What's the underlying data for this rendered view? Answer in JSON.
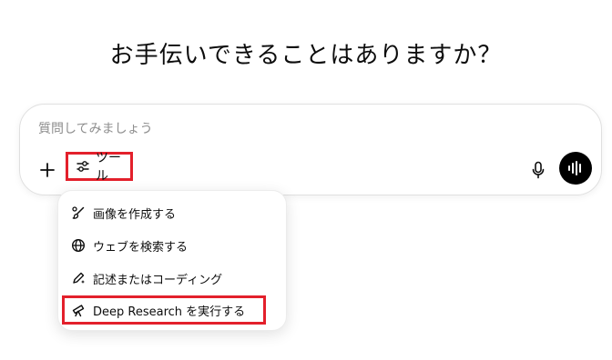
{
  "heading": "お手伝いできることはありますか？",
  "composer": {
    "placeholder": "質問してみましょう",
    "add_icon": "plus-icon",
    "tools_label": "ツール",
    "tools_icon": "sliders-icon",
    "mic_icon": "microphone-icon",
    "voice_icon": "waveform-icon"
  },
  "tools_menu": {
    "items": [
      {
        "label": "画像を作成する",
        "icon": "brush-icon"
      },
      {
        "label": "ウェブを検索する",
        "icon": "globe-icon"
      },
      {
        "label": "記述またはコーディング",
        "icon": "pen-sparkle-icon"
      },
      {
        "label": "Deep Research を実行する",
        "icon": "telescope-icon"
      }
    ]
  },
  "colors": {
    "highlight_border": "#e3202b",
    "voice_button_bg": "#000000",
    "text": "#0d0d0d",
    "placeholder": "#8e8e8e"
  }
}
